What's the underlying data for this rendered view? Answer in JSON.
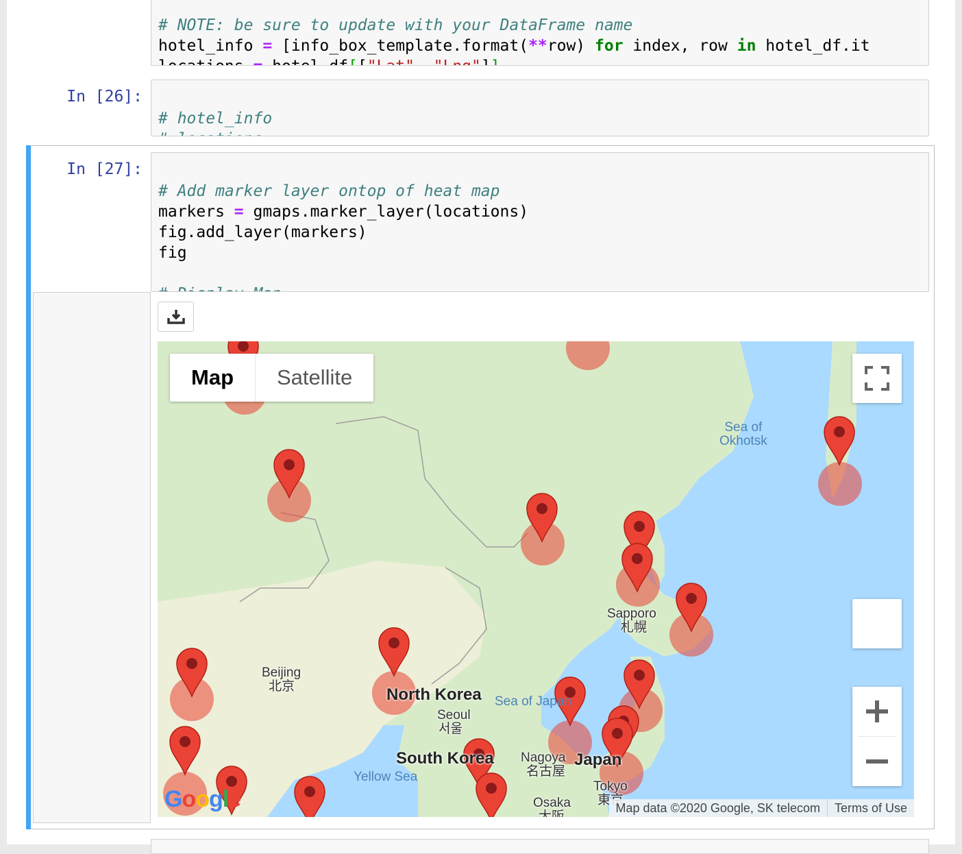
{
  "cells": {
    "top": {
      "line1": "# NOTE: be sure to update with your DataFrame name",
      "line2_a": "hotel_info ",
      "line2_op": "=",
      "line2_b": " [info_box_template.format(",
      "line2_op2": "**",
      "line2_c": "row) ",
      "line2_kw1": "for",
      "line2_d": " index, row ",
      "line2_kw2": "in",
      "line2_e": " hotel_df.it",
      "line3_a": "locations ",
      "line3_op": "=",
      "line3_b": " hotel_df",
      "line3_br1": "[",
      "line3_br2": "[",
      "line3_s1": "\"Lat\"",
      "line3_c": ", ",
      "line3_s2": "\"Lng\"",
      "line3_br3": "]",
      "line3_br4": "]"
    },
    "cell26": {
      "prompt": "In [26]:",
      "line1": "# hotel_info",
      "line2": "# locations"
    },
    "cell27": {
      "prompt": "In [27]:",
      "line1": "# Add marker layer ontop of heat map",
      "line2_a": "markers ",
      "line2_op": "=",
      "line2_b": " gmaps.marker_layer(locations)",
      "line3": "fig.add_layer(markers)",
      "line4": "fig",
      "line5": "# Display Map"
    }
  },
  "map": {
    "type_map": "Map",
    "type_satellite": "Satellite",
    "labels": {
      "sea_okhotsk": "Sea of\nOkhotsk",
      "sapporo": "Sapporo",
      "sapporo_jp": "札幌",
      "beijing": "Beijing",
      "beijing_cn": "北京",
      "north_korea": "North Korea",
      "sea_japan": "Sea of Japan",
      "seoul": "Seoul",
      "seoul_kr": "서울",
      "south_korea": "South Korea",
      "yellow_sea": "Yellow Sea",
      "nagoya": "Nagoya",
      "nagoya_jp": "名古屋",
      "japan": "Japan",
      "tokyo": "Tokyo",
      "tokyo_jp": "東京",
      "osaka": "Osaka",
      "osaka_jp": "大阪"
    },
    "attribution": "Map data ©2020 Google, SK telecom",
    "terms": "Terms of Use",
    "logo": "Google",
    "colors": {
      "water": "#aadaff",
      "land": "#d8ebc9",
      "marker": "#ea4335",
      "marker_dot": "#8b1a1a"
    }
  }
}
